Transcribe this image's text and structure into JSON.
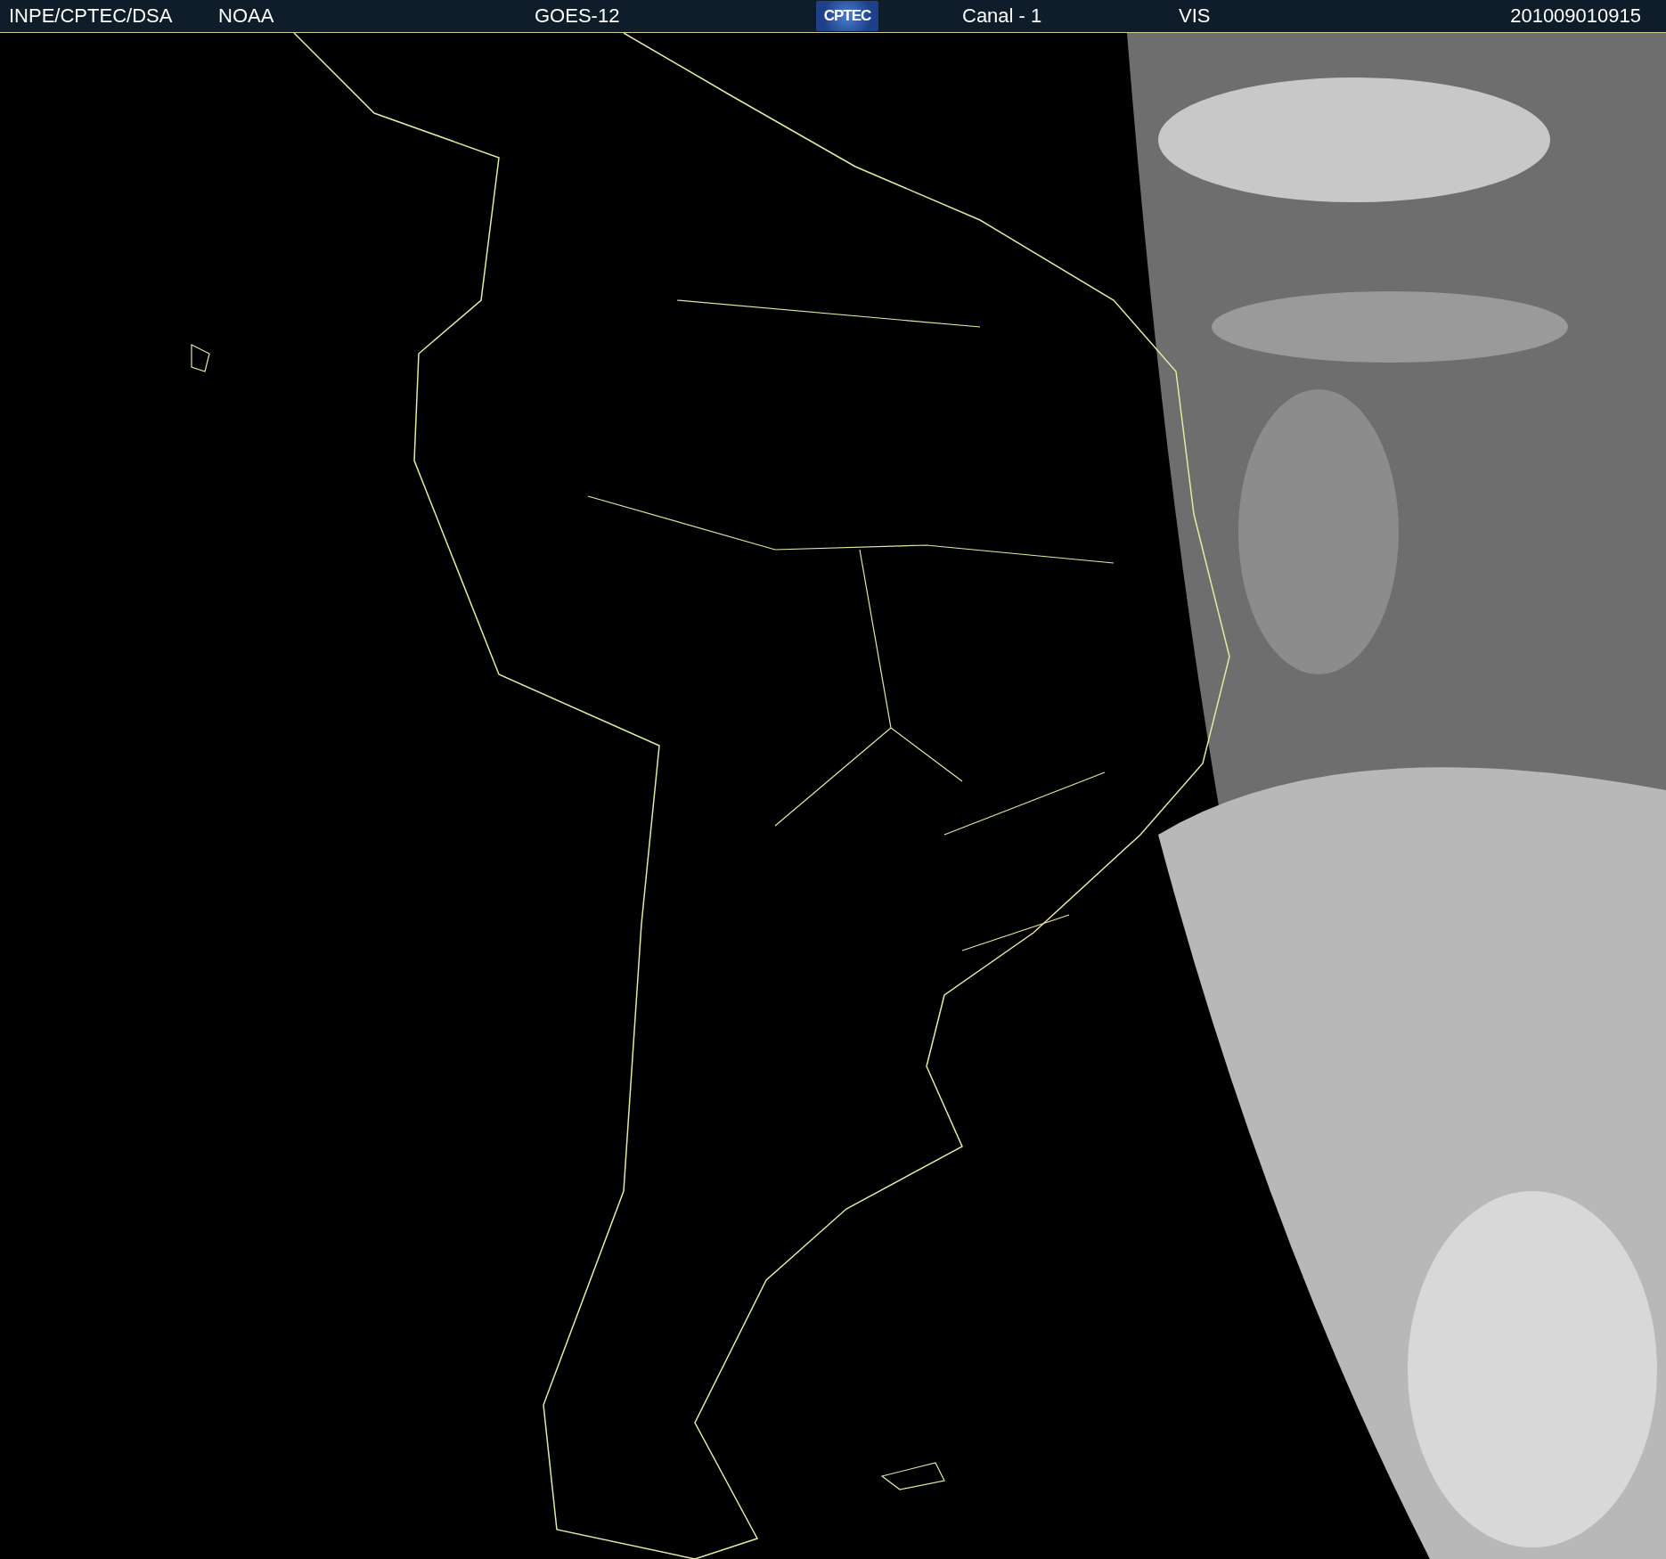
{
  "header": {
    "source": "INPE/CPTEC/DSA",
    "agency": "NOAA",
    "satellite": "GOES-12",
    "logo": "CPTEC",
    "channel": "Canal - 1",
    "band": "VIS",
    "timestamp": "201009010915"
  }
}
